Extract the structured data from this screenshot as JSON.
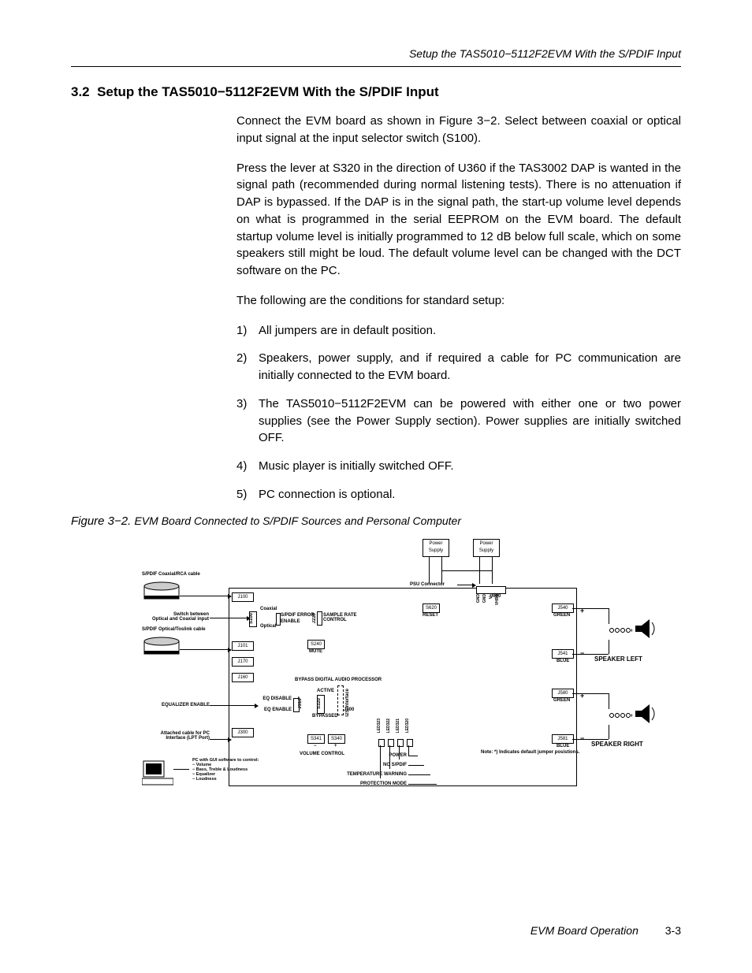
{
  "header": {
    "running": "Setup the TAS5010−5112F2EVM With the S/PDIF Input"
  },
  "section": {
    "number": "3.2",
    "title": "Setup the TAS5010−5112F2EVM With the S/PDIF Input"
  },
  "paragraphs": {
    "p1": "Connect the EVM board as shown in Figure 3−2. Select between coaxial or optical input signal at the input selector switch (S100).",
    "p2": "Press the lever at S320 in the direction of U360 if the TAS3002 DAP is wanted in the signal path (recommended during normal listening tests). There is no attenuation if DAP is bypassed. If the DAP is in the signal path, the start-up volume level depends on what is programmed in the serial EEPROM on the EVM board. The default startup volume level is initially programmed to 12 dB below full scale, which on some speakers still might be loud. The default volume level can be changed with the DCT software on the PC.",
    "p3": "The following are the conditions for standard setup:"
  },
  "list": [
    {
      "n": "1)",
      "t": "All jumpers are in default position."
    },
    {
      "n": "2)",
      "t": "Speakers, power supply, and if required a cable for PC communication are initially connected to the EVM board."
    },
    {
      "n": "3)",
      "t": "The TAS5010−5112F2EVM can be powered with either one or two power supplies (see the Power Supply section). Power supplies are initially switched OFF."
    },
    {
      "n": "4)",
      "t": "Music player is initially switched OFF."
    },
    {
      "n": "5)",
      "t": "PC connection is optional."
    }
  ],
  "figure": {
    "caption_num": "Figure 3−2.",
    "caption_txt": "EVM Board Connected to S/PDIF Sources and Personal Computer"
  },
  "diagram": {
    "power_supply": "Power\nSupply",
    "psu_connector": "PSU Connector",
    "j600": "J600",
    "pins": [
      "GND",
      "GND",
      "V+",
      "VHBR"
    ],
    "spdif_coax": "S/PDIF Coaxial/RCA cable",
    "spdif_opt": "S/PDIF Optical/Toslink cable",
    "switch_between": "Switch between\nOptical and Coaxial input",
    "j100": "J100",
    "j101": "J101",
    "j170": "J170",
    "j160": "J160",
    "j300": "J300",
    "j540": "J540",
    "j541": "J541",
    "j580": "J580",
    "j581": "J581",
    "coaxial": "Coaxial",
    "optical": "Optical",
    "s100": "S100",
    "spdif_error": "S/PDIF ERROR",
    "enable": "ENABLE",
    "j220": "J220",
    "sample_rate": "SAMPLE RATE\nCONTROL",
    "s240": "S240",
    "mute": "MUTE",
    "s620": "S620",
    "reset": "RESET",
    "bypass_dap": "BYPASS DIGITAL AUDIO PROCESSOR",
    "eq_enable_lbl": "EQUALIZER ENABLE",
    "eq_disable": "EQ DISABLE",
    "eq_enable": "EQ ENABLE",
    "active": "ACTIVE",
    "bypassed": "BYPASSED",
    "s320": "S320",
    "j310": "J310*",
    "j400": "J400",
    "i2s": "I2S Interface",
    "attached_cable": "Attached cable for PC\nInterface (LPT Port)",
    "s341": "S341",
    "s340": "S340",
    "vol_minus": "−",
    "vol_plus": "+",
    "volume_control": "VOLUME CONTROL",
    "leds": [
      "LED323",
      "LED322",
      "LED321",
      "LED320"
    ],
    "led_power": "POWER",
    "led_no": "NO S/PDIF",
    "led_temp": "TEMPERATURE WARNING",
    "led_prot": "PROTECTION MODE",
    "pc_text": "PC with GUI software to control:\n − Volume\n − Bass, Treble &  Loudness\n − Equalizer\n − Loudness",
    "note": "Note: *) Indicates default jumper posistions.",
    "green": "GREEN",
    "blue": "BLUE",
    "plus": "+",
    "minus": "−",
    "speaker_left": "SPEAKER LEFT",
    "speaker_right": "SPEAKER RIGHT"
  },
  "footer": {
    "title": "EVM Board Operation",
    "page": "3-3"
  }
}
